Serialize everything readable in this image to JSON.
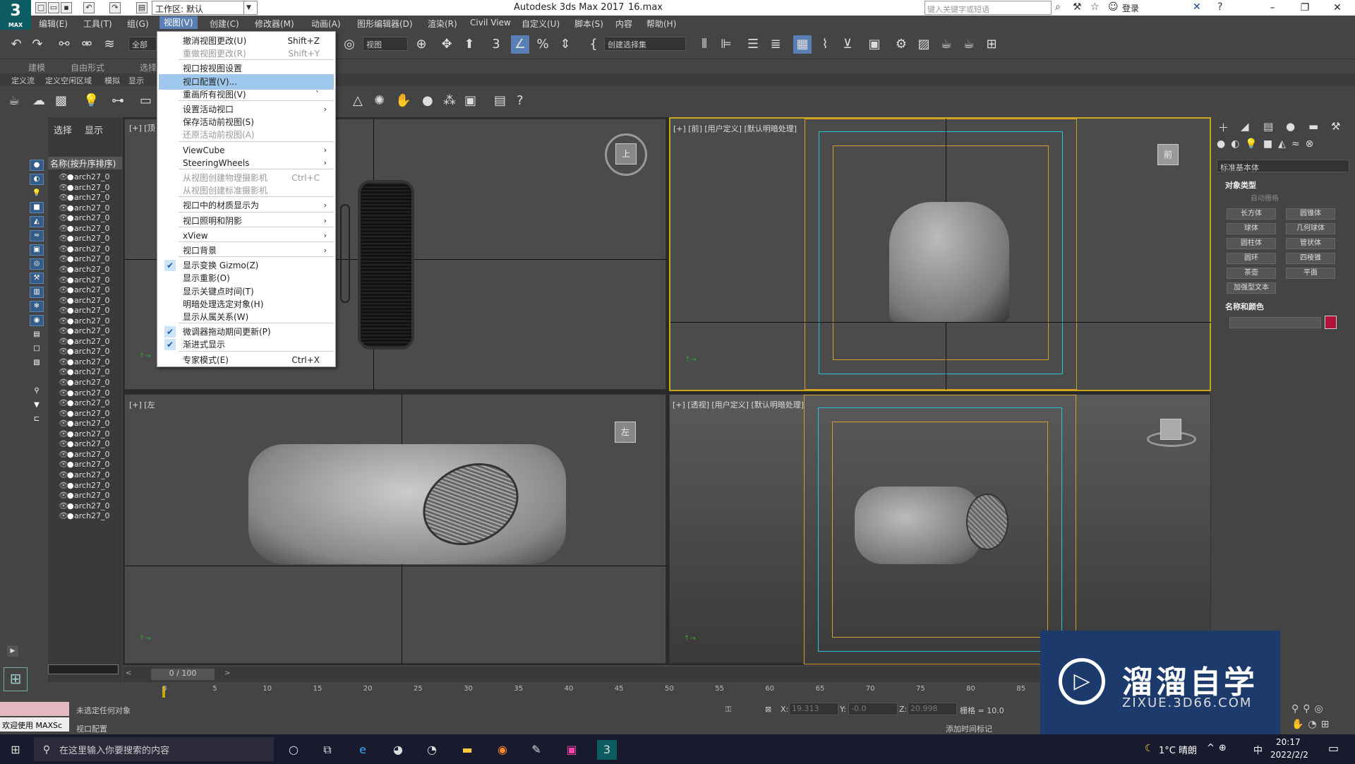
{
  "app": {
    "logo": "3",
    "logo_sub": "MAX",
    "title": "Autodesk 3ds Max 2017",
    "file": "16.max"
  },
  "workspace": {
    "label": "工作区: 默认"
  },
  "search": {
    "placeholder": "键入关键字或短语"
  },
  "account": {
    "login": "登录"
  },
  "menubar": [
    "编辑(E)",
    "工具(T)",
    "组(G)",
    "视图(V)",
    "创建(C)",
    "修改器(M)",
    "动画(A)",
    "图形编辑器(D)",
    "渲染(R)",
    "Civil View",
    "自定义(U)",
    "脚本(S)",
    "内容",
    "帮助(H)"
  ],
  "toolbar": {
    "filter": "全部",
    "view_dd": "视图",
    "selset": "创建选择集"
  },
  "ribbon": {
    "tabs": [
      "建模",
      "自由形式",
      "选择"
    ],
    "row2": [
      "定义流",
      "定义空闲区域",
      "模拟",
      "显示"
    ]
  },
  "scene": {
    "tabs": [
      "选择",
      "显示"
    ],
    "header": "名称(按升序排序)",
    "item": "arch27_0",
    "count": 34
  },
  "viewports": {
    "top_label": "[+] [顶",
    "front_label": "[+] [前] [用户定义] [默认明暗处理]",
    "left_label": "[+] [左",
    "persp_label": "[+] [透视] [用户定义] [默认明暗处理]",
    "cube_top": "上",
    "cube_front": "前",
    "cube_left": "左"
  },
  "dropdown": {
    "items": [
      {
        "label": "撤消视图更改(U)",
        "shortcut": "Shift+Z"
      },
      {
        "label": "重做视图更改(R)",
        "shortcut": "Shift+Y",
        "disabled": true
      },
      {
        "sep": true
      },
      {
        "label": "视口按视图设置"
      },
      {
        "label": "视口配置(V)...",
        "highlight": true
      },
      {
        "label": "重画所有视图(V)",
        "shortcut": "`"
      },
      {
        "sep": true
      },
      {
        "label": "设置活动视口",
        "arrow": true
      },
      {
        "label": "保存活动前视图(S)"
      },
      {
        "label": "还原活动前视图(A)",
        "disabled": true
      },
      {
        "sep": true
      },
      {
        "label": "ViewCube",
        "arrow": true
      },
      {
        "label": "SteeringWheels",
        "arrow": true
      },
      {
        "sep": true
      },
      {
        "label": "从视图创建物理摄影机",
        "shortcut": "Ctrl+C",
        "disabled": true
      },
      {
        "label": "从视图创建标准摄影机",
        "disabled": true
      },
      {
        "sep": true
      },
      {
        "label": "视口中的材质显示为",
        "arrow": true
      },
      {
        "sep": true
      },
      {
        "label": "视口照明和阴影",
        "arrow": true
      },
      {
        "sep": true
      },
      {
        "label": "xView",
        "arrow": true
      },
      {
        "sep": true
      },
      {
        "label": "视口背景",
        "arrow": true
      },
      {
        "sep": true
      },
      {
        "label": "显示变换 Gizmo(Z)",
        "checked": true
      },
      {
        "label": "显示重影(O)"
      },
      {
        "label": "显示关键点时间(T)"
      },
      {
        "label": "明暗处理选定对象(H)"
      },
      {
        "label": "显示从属关系(W)"
      },
      {
        "sep": true
      },
      {
        "label": "微调器拖动期间更新(P)",
        "checked": true
      },
      {
        "label": "渐进式显示",
        "checked": true
      },
      {
        "sep": true
      },
      {
        "label": "专家模式(E)",
        "shortcut": "Ctrl+X"
      }
    ]
  },
  "cmdpanel": {
    "category": "标准基本体",
    "object_type": "对象类型",
    "autogrid": "自动栅格",
    "buttons": [
      "长方体",
      "圆锥体",
      "球体",
      "几何球体",
      "圆柱体",
      "管状体",
      "圆环",
      "四棱锥",
      "茶壶",
      "平面",
      "加强型文本"
    ],
    "name_color": "名称和颜色",
    "color": "#b0123b"
  },
  "timeline": {
    "frame": "0 / 100",
    "ticks": [
      "0",
      "5",
      "10",
      "15",
      "20",
      "25",
      "30",
      "35",
      "40",
      "45",
      "50",
      "55",
      "60",
      "65",
      "70",
      "75",
      "80",
      "85"
    ]
  },
  "status": {
    "msg1": "未选定任何对象",
    "msg2": "视口配置",
    "welcome": "欢迎使用 MAXSc",
    "x": "19.313",
    "y": "-0.0",
    "z": "20.998",
    "grid": "栅格 = 10.0",
    "addtime": "添加时间标记"
  },
  "taskbar": {
    "search": "在这里输入你要搜索的内容",
    "weather": "1°C 晴朗",
    "time": "20:17",
    "date": "2022/2/2",
    "ime": "中"
  },
  "watermark": {
    "text": "溜溜自学",
    "url": "ZIXUE.3D66.COM"
  }
}
